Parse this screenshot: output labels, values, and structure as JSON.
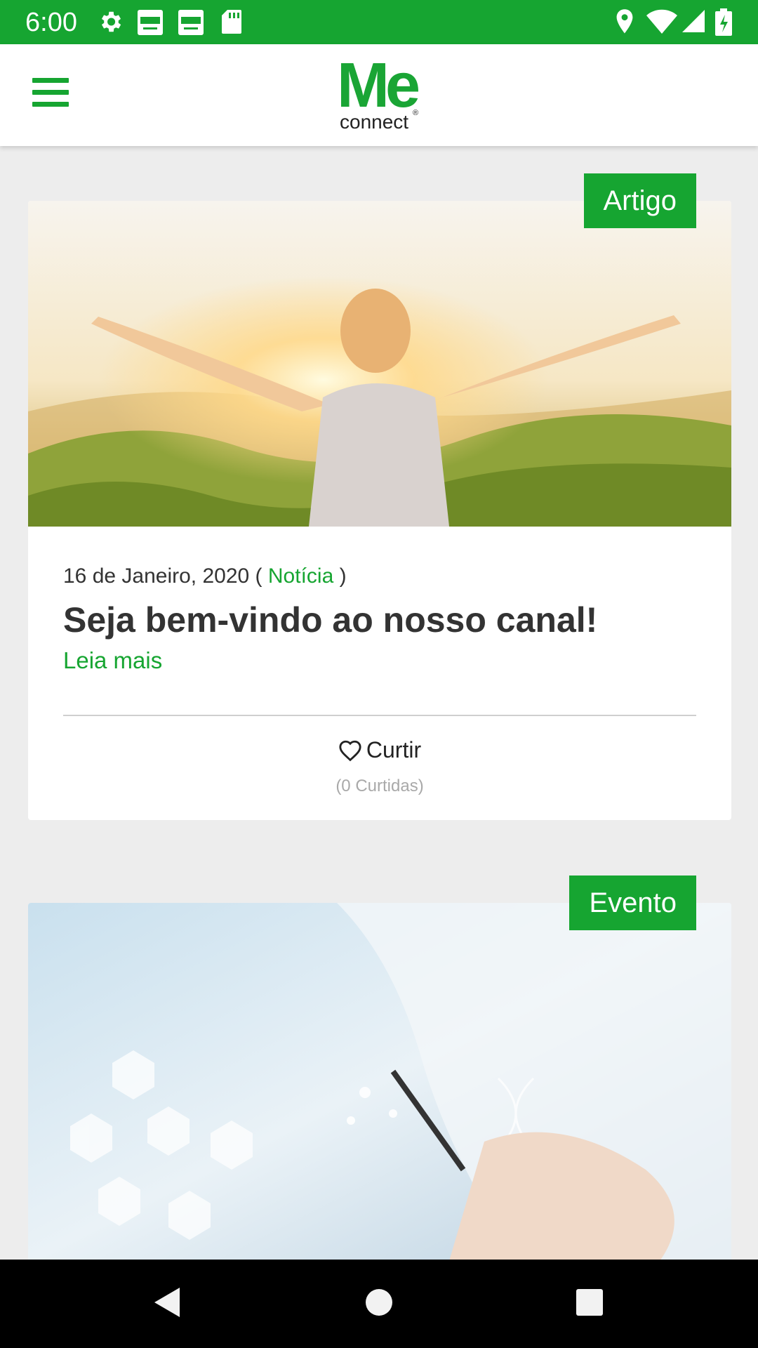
{
  "status_bar": {
    "time": "6:00",
    "icons": [
      "gear-icon",
      "lide-notification-icon",
      "lide-notification-icon",
      "sd-card-icon",
      "location-icon",
      "wifi-icon",
      "signal-icon",
      "battery-icon"
    ]
  },
  "header": {
    "logo_main": "Me",
    "logo_sub": "connect",
    "logo_mark": "®"
  },
  "posts": [
    {
      "tag": "Artigo",
      "date": "16 de Janeiro, 2020",
      "meta_open": " ( ",
      "category": "Notícia",
      "meta_close": " )",
      "title": "Seja bem-vindo ao nosso canal!",
      "read_more": "Leia mais",
      "like_label": "Curtir",
      "likes_text": "(0 Curtidas)"
    },
    {
      "tag": "Evento"
    }
  ],
  "colors": {
    "brand": "#16a531",
    "background": "#ededed",
    "text": "#333333",
    "muted": "#a9a9a9"
  }
}
